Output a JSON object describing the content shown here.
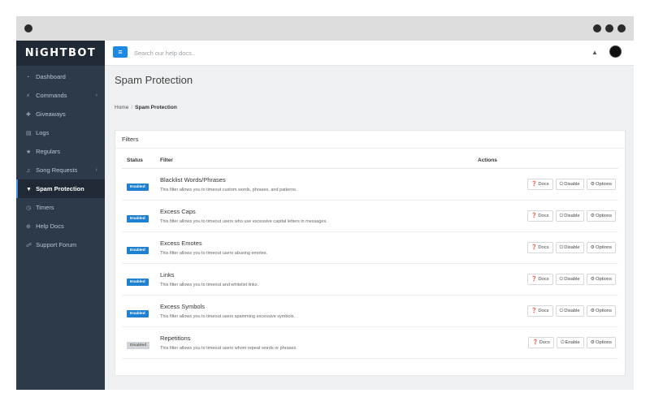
{
  "app": {
    "brand": "NiGHTBOT"
  },
  "sidebar": {
    "items": [
      {
        "label": "Dashboard",
        "icon": "dashboard-icon",
        "glyph": "◔",
        "chevron": ""
      },
      {
        "label": "Commands",
        "icon": "magic-wand-icon",
        "glyph": "⚡",
        "chevron": "‹"
      },
      {
        "label": "Giveaways",
        "icon": "gift-icon",
        "glyph": "✚",
        "chevron": ""
      },
      {
        "label": "Logs",
        "icon": "logs-icon",
        "glyph": "▤",
        "chevron": ""
      },
      {
        "label": "Regulars",
        "icon": "star-icon",
        "glyph": "★",
        "chevron": ""
      },
      {
        "label": "Song Requests",
        "icon": "music-icon",
        "glyph": "♫",
        "chevron": "‹"
      },
      {
        "label": "Spam Protection",
        "icon": "filter-icon",
        "glyph": "▼",
        "chevron": ""
      },
      {
        "label": "Timers",
        "icon": "clock-icon",
        "glyph": "◷",
        "chevron": ""
      },
      {
        "label": "Help Docs",
        "icon": "help-icon",
        "glyph": "⊕",
        "chevron": ""
      },
      {
        "label": "Support Forum",
        "icon": "chat-icon",
        "glyph": "☍",
        "chevron": ""
      }
    ]
  },
  "topbar": {
    "menu_glyph": "≡",
    "search_placeholder": "Search our help docs..",
    "bell_glyph": "▲"
  },
  "page": {
    "title": "Spam Protection"
  },
  "breadcrumb": {
    "home": "Home",
    "separator": "/",
    "current": "Spam Protection"
  },
  "panel": {
    "heading": "Filters"
  },
  "table": {
    "headers": {
      "status": "Status",
      "filter": "Filter",
      "actions": "Actions"
    },
    "rows": [
      {
        "status": "Enabled",
        "name": "Blacklist Words/Phrases",
        "desc": "This filter allows you to timeout custom words, phrases, and patterns.",
        "docs": "Docs",
        "toggle": "Disable",
        "options": "Options"
      },
      {
        "status": "Enabled",
        "name": "Excess Caps",
        "desc": "This filter allows you to timeout users who use excessive capital letters in messages.",
        "docs": "Docs",
        "toggle": "Disable",
        "options": "Options"
      },
      {
        "status": "Enabled",
        "name": "Excess Emotes",
        "desc": "This filter allows you to timeout users abusing emotes.",
        "docs": "Docs",
        "toggle": "Disable",
        "options": "Options"
      },
      {
        "status": "Enabled",
        "name": "Links",
        "desc": "This filter allows you to timeout and whitelist links.",
        "docs": "Docs",
        "toggle": "Disable",
        "options": "Options"
      },
      {
        "status": "Enabled",
        "name": "Excess Symbols",
        "desc": "This filter allows you to timeout users spamming excessive symbols.",
        "docs": "Docs",
        "toggle": "Disable",
        "options": "Options"
      },
      {
        "status": "Disabled",
        "name": "Repetitions",
        "desc": "This filter allows you to timeout users whom repeat words or phrases.",
        "docs": "Docs",
        "toggle": "Enable",
        "options": "Options"
      }
    ]
  },
  "action_glyphs": {
    "docs": "❓",
    "toggle": "⏻",
    "options": "⚙"
  },
  "colors": {
    "accent": "#1e88e5",
    "sidebar_bg": "#2c3a4a",
    "enabled_badge": "#1f7fd0",
    "disabled_badge": "#d0d4d8"
  }
}
